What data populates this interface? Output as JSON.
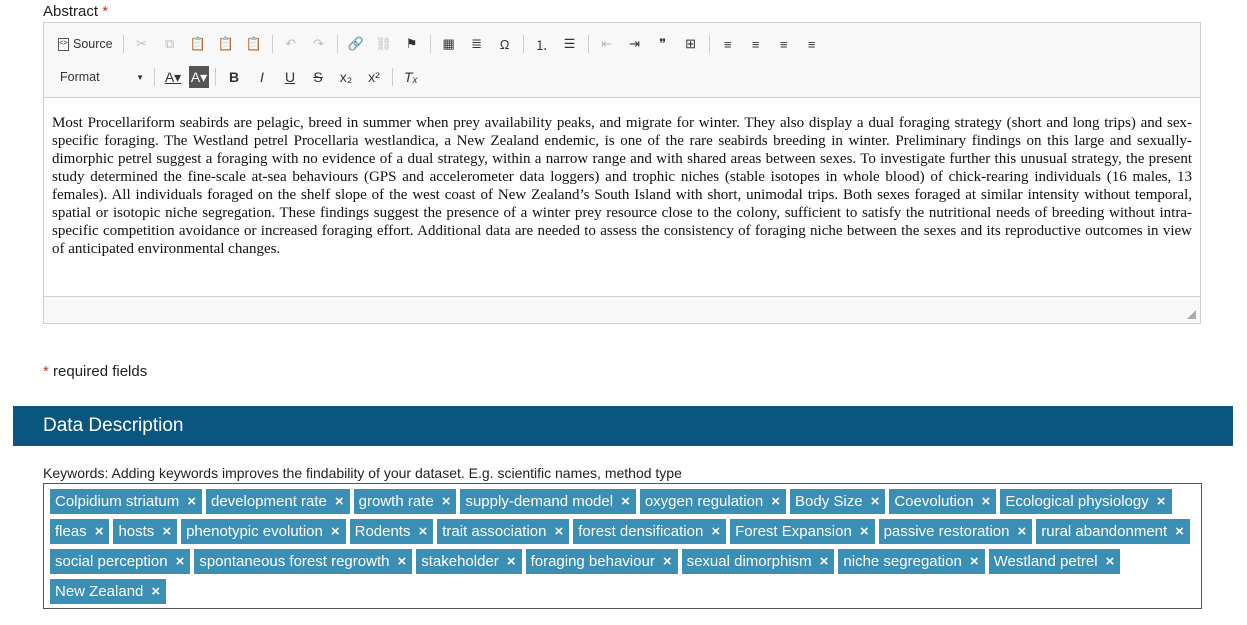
{
  "abstract": {
    "label": "Abstract",
    "required_mark": "*",
    "toolbar": {
      "source_label": "Source",
      "format_label": "Format",
      "icons_row1": [
        {
          "name": "cut-icon",
          "glyph": "✂",
          "disabled": true
        },
        {
          "name": "copy-icon",
          "glyph": "⧉",
          "disabled": true
        },
        {
          "name": "paste-icon",
          "glyph": "📋",
          "disabled": false
        },
        {
          "name": "paste-text-icon",
          "glyph": "📋",
          "disabled": false
        },
        {
          "name": "paste-word-icon",
          "glyph": "📋",
          "disabled": false
        },
        {
          "name": "sep",
          "glyph": ""
        },
        {
          "name": "undo-icon",
          "glyph": "↶",
          "disabled": true
        },
        {
          "name": "redo-icon",
          "glyph": "↷",
          "disabled": true
        },
        {
          "name": "sep",
          "glyph": ""
        },
        {
          "name": "link-icon",
          "glyph": "🔗",
          "disabled": false
        },
        {
          "name": "unlink-icon",
          "glyph": "⛓",
          "disabled": true
        },
        {
          "name": "anchor-flag-icon",
          "glyph": "⚑",
          "disabled": false
        },
        {
          "name": "sep",
          "glyph": ""
        },
        {
          "name": "table-icon",
          "glyph": "▦",
          "disabled": false
        },
        {
          "name": "horizontal-line-icon",
          "glyph": "≣",
          "disabled": false
        },
        {
          "name": "special-char-icon",
          "glyph": "Ω",
          "disabled": false
        },
        {
          "name": "sep",
          "glyph": ""
        },
        {
          "name": "numbered-list-icon",
          "glyph": "⒈",
          "disabled": false
        },
        {
          "name": "bulleted-list-icon",
          "glyph": "☰",
          "disabled": false
        },
        {
          "name": "sep",
          "glyph": ""
        },
        {
          "name": "outdent-icon",
          "glyph": "⇤",
          "disabled": true
        },
        {
          "name": "indent-icon",
          "glyph": "⇥",
          "disabled": false
        },
        {
          "name": "blockquote-icon",
          "glyph": "❞",
          "disabled": false
        },
        {
          "name": "div-icon",
          "glyph": "⊞",
          "disabled": false
        },
        {
          "name": "sep",
          "glyph": ""
        },
        {
          "name": "align-left-icon",
          "glyph": "≡",
          "disabled": false
        },
        {
          "name": "align-center-icon",
          "glyph": "≡",
          "disabled": false
        },
        {
          "name": "align-right-icon",
          "glyph": "≡",
          "disabled": false
        },
        {
          "name": "justify-icon",
          "glyph": "≡",
          "disabled": false
        }
      ],
      "icons_row2": [
        {
          "name": "text-color-icon",
          "glyph": "A▾",
          "style": "u"
        },
        {
          "name": "bg-color-icon",
          "glyph": "A▾",
          "style": "bg"
        },
        {
          "name": "sep",
          "glyph": ""
        },
        {
          "name": "bold-icon",
          "glyph": "B",
          "style": "b"
        },
        {
          "name": "italic-icon",
          "glyph": "I",
          "style": "i"
        },
        {
          "name": "underline-icon",
          "glyph": "U",
          "style": "u"
        },
        {
          "name": "strike-icon",
          "glyph": "S",
          "style": "s"
        },
        {
          "name": "subscript-icon",
          "glyph": "x₂",
          "style": ""
        },
        {
          "name": "superscript-icon",
          "glyph": "x²",
          "style": ""
        },
        {
          "name": "sep",
          "glyph": ""
        },
        {
          "name": "remove-format-icon",
          "glyph": "Tₓ",
          "style": "i"
        }
      ]
    },
    "text": "Most Procellariform seabirds are pelagic, breed in summer when prey availability peaks, and migrate for winter. They also display a dual foraging strategy (short and long trips) and sex-specific foraging. The Westland petrel Procellaria westlandica, a New Zealand endemic, is one of the rare seabirds breeding in winter. Preliminary findings on this large and sexually-dimorphic petrel suggest a foraging with no evidence of a dual strategy, within a narrow range and with shared areas between sexes. To investigate further this unusual strategy, the present study determined the fine-scale at-sea behaviours (GPS and accelerometer data loggers) and trophic niches (stable isotopes in whole blood) of chick-rearing individuals (16 males, 13 females). All individuals foraged on the shelf slope of the west coast of New Zealand’s South Island with short, unimodal trips. Both sexes foraged at similar intensity without temporal, spatial or isotopic niche segregation. These findings suggest the presence of a winter prey resource close to the colony, sufficient to satisfy the nutritional needs of breeding without intra-specific competition avoidance or increased foraging effort. Additional data are needed to assess the consistency of foraging niche between the sexes and its reproductive outcomes in view of anticipated environmental changes."
  },
  "required_note": {
    "mark": "*",
    "text": "required fields"
  },
  "section": {
    "title": "Data Description"
  },
  "keywords": {
    "label": "Keywords:  Adding keywords improves the findability of your dataset. E.g. scientific names, method type",
    "remove_glyph": "×",
    "tags": [
      "Colpidium striatum",
      "development rate",
      "growth rate",
      "supply-demand model",
      "oxygen regulation",
      "Body Size",
      "Coevolution",
      "Ecological physiology",
      "fleas",
      "hosts",
      "phenotypic evolution",
      "Rodents",
      "trait association",
      "forest densification",
      "Forest Expansion",
      "passive restoration",
      "rural abandonment",
      "social perception",
      "spontaneous forest regrowth",
      "stakeholder",
      "foraging behaviour",
      "sexual dimorphism",
      "niche segregation",
      "Westland petrel",
      "New Zealand"
    ]
  },
  "colors": {
    "section_bar": "#0a5681",
    "tag_bg": "#3b8fb5",
    "required": "#c0392b"
  }
}
